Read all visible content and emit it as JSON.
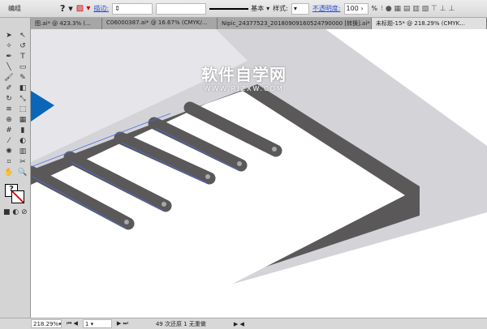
{
  "control_bar": {
    "selection": "编组",
    "stroke_label": "描边:",
    "stroke_style": "基本",
    "style_label": "样式:",
    "opacity_label": "不透明度:",
    "opacity_value": "100",
    "opacity_unit": "%"
  },
  "tabs": [
    {
      "label": "图.ai* @ 423.3% (..."
    },
    {
      "label": "C06000387.ai* @ 16.67% (CMYK/..."
    },
    {
      "label": "Nipic_24377523_20180909160524790000 [转换].ai*"
    },
    {
      "label": "未标题-15* @ 218.29% (CMYK..."
    }
  ],
  "watermark": {
    "title": "软件自学网",
    "url": "WWW.RJZXW.COM"
  },
  "status": {
    "zoom": "218.29%",
    "page": "1",
    "message": "49 次还原 1 无重做"
  },
  "colors": {
    "key": "#5a5859",
    "accent": "#0a66b8",
    "selection": "#4a6ee0"
  }
}
